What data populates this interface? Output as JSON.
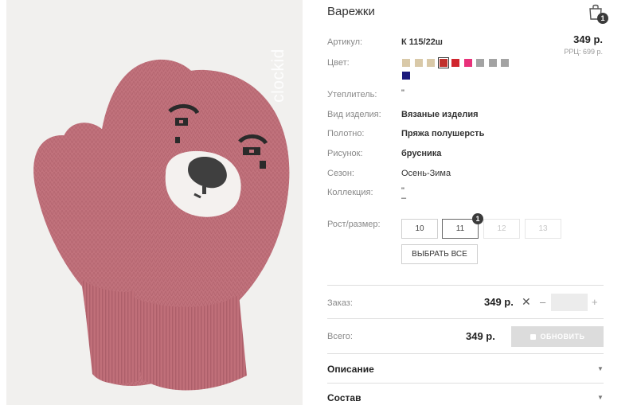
{
  "product": {
    "title": "Варежки",
    "cart_count": "1",
    "watermark": "clockid"
  },
  "pricing": {
    "price": "349 р.",
    "rrc": "РРЦ: 699 р."
  },
  "attributes": {
    "article_label": "Артикул:",
    "article_value": "К 115/22ш",
    "color_label": "Цвет:",
    "insulation_label": "Утеплитель:",
    "insulation_value": "\"",
    "type_label": "Вид изделия:",
    "type_value": "Вязаные изделия",
    "fabric_label": "Полотно:",
    "fabric_value": "Пряжа полушерсть",
    "pattern_label": "Рисунок:",
    "pattern_value": "брусника",
    "season_label": "Сезон:",
    "season_value": "Осень-Зима",
    "collection_label": "Коллекция:",
    "collection_value_1": "\"",
    "collection_value_2": "–"
  },
  "colors": [
    {
      "hex": "#d9c9a8",
      "selected": false
    },
    {
      "hex": "#d9c9a8",
      "selected": false
    },
    {
      "hex": "#d9c9a8",
      "selected": false
    },
    {
      "hex": "#c0302c",
      "selected": true
    },
    {
      "hex": "#d0262e",
      "selected": false
    },
    {
      "hex": "#e8317a",
      "selected": false
    },
    {
      "hex": "#a3a3a3",
      "selected": false
    },
    {
      "hex": "#a3a3a3",
      "selected": false
    },
    {
      "hex": "#a3a3a3",
      "selected": false
    },
    {
      "hex": "#1c1a7c",
      "selected": false
    }
  ],
  "sizes": {
    "label": "Рост/размер:",
    "items": [
      {
        "label": "10",
        "state": "available"
      },
      {
        "label": "11",
        "state": "selected"
      },
      {
        "label": "12",
        "state": "disabled"
      },
      {
        "label": "13",
        "state": "disabled"
      }
    ],
    "selected_badge": "1",
    "select_all": "ВЫБРАТЬ ВСЕ"
  },
  "order": {
    "label": "Заказ:",
    "price": "349 р.",
    "remove_icon": "close-icon",
    "minus": "–",
    "plus": "+",
    "quantity": ""
  },
  "total": {
    "label": "Всего:",
    "price": "349 р.",
    "update_button": "ОБНОВИТЬ"
  },
  "accordion": [
    {
      "title": "Описание"
    },
    {
      "title": "Состав"
    }
  ]
}
